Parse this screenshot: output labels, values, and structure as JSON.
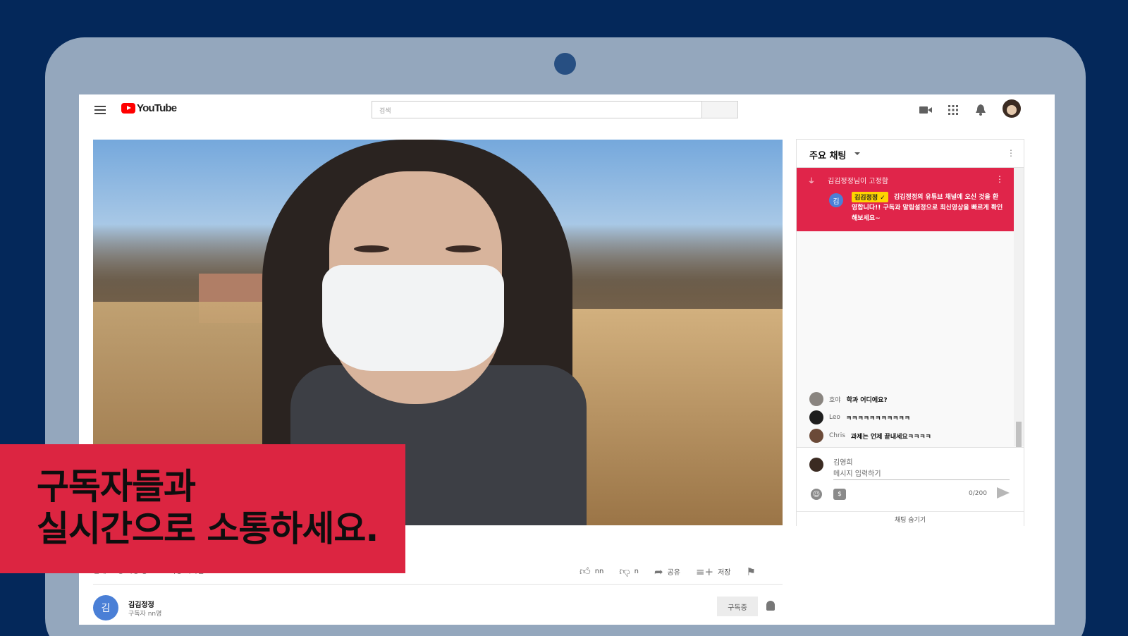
{
  "header": {
    "logo_text": "YouTube",
    "search_placeholder": "검색",
    "icons": [
      "create-video-icon",
      "apps-grid-icon",
      "notifications-bell-icon"
    ]
  },
  "chat": {
    "title": "주요 채팅",
    "pinned": {
      "pinned_by": "김김정정님이 고정함",
      "avatar_letter": "김",
      "author_badge": "김김정정 ✓",
      "message": "김김정정의 유튜브 채널에 오신 것을 환영합니다!! 구독과 알림설정으로 최신영상을 빠르게 확인해보세요~"
    },
    "messages": [
      {
        "author": "호야",
        "text": "학과 어디에요?",
        "avatar_color": "#8a8580"
      },
      {
        "author": "Leo",
        "text": "ㅋㅋㅋㅋㅋㅋㅋㅋㅋㅋㅋ",
        "avatar_color": "#1e1e1e"
      },
      {
        "author": "Chris",
        "text": "과제는 언제 끝내세요ㅋㅋㅋㅋ",
        "avatar_color": "#6b4a38"
      }
    ],
    "input": {
      "user_name": "김영희",
      "placeholder": "메시지 입력하기",
      "char_count": "0/200",
      "money_symbol": "$"
    },
    "hide_label": "채팅 숨기기"
  },
  "video_meta": {
    "status": "현재 nn명 시청 중 • 스트리밍 시작일: 2020. 12. 1",
    "like_count": "nn",
    "dislike_count": "n",
    "share_label": "공유",
    "save_label": "저장"
  },
  "channel": {
    "avatar_letter": "김",
    "name": "김김정정",
    "subscribers": "구독자 nn명",
    "subscribe_label": "구독중"
  },
  "caption": {
    "text": "구독자들과\n실시간으로 소통하세요."
  },
  "colors": {
    "background": "#04285a",
    "tablet": "#94a7bd",
    "accent_red": "#dc2541",
    "pinned_red": "#e0254a",
    "badge_yellow": "#ffd400"
  }
}
